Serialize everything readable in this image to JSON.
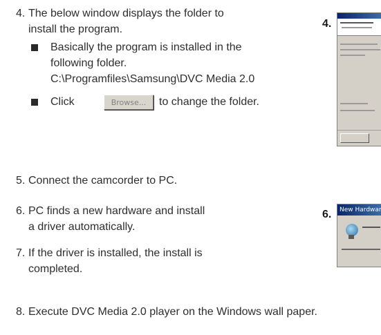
{
  "steps": {
    "s4": {
      "number": "4.",
      "line1": "The below window displays the folder to",
      "line2": "install the program.",
      "bullet1": {
        "line1": "Basically the program is installed in the",
        "line2": "following folder.",
        "line3": "C:\\Programfiles\\Samsung\\DVC Media 2.0"
      },
      "bullet2": {
        "before": "Click",
        "button_label": "Browse...",
        "after": "to change the folder."
      }
    },
    "s5": {
      "number": "5.",
      "text": "Connect the camcorder to PC."
    },
    "s6": {
      "number": "6.",
      "line1": "PC finds a new hardware and install",
      "line2": "a driver automatically."
    },
    "s7": {
      "number": "7.",
      "line1": "If the driver is installed, the install is",
      "line2": "completed."
    },
    "s8": {
      "number": "8.",
      "text": "Execute DVC Media 2.0 player on the Windows wall paper."
    }
  },
  "figures": {
    "fig4_label": "4.",
    "fig6_label": "6.",
    "fig6_title": "New Hardware Found"
  }
}
